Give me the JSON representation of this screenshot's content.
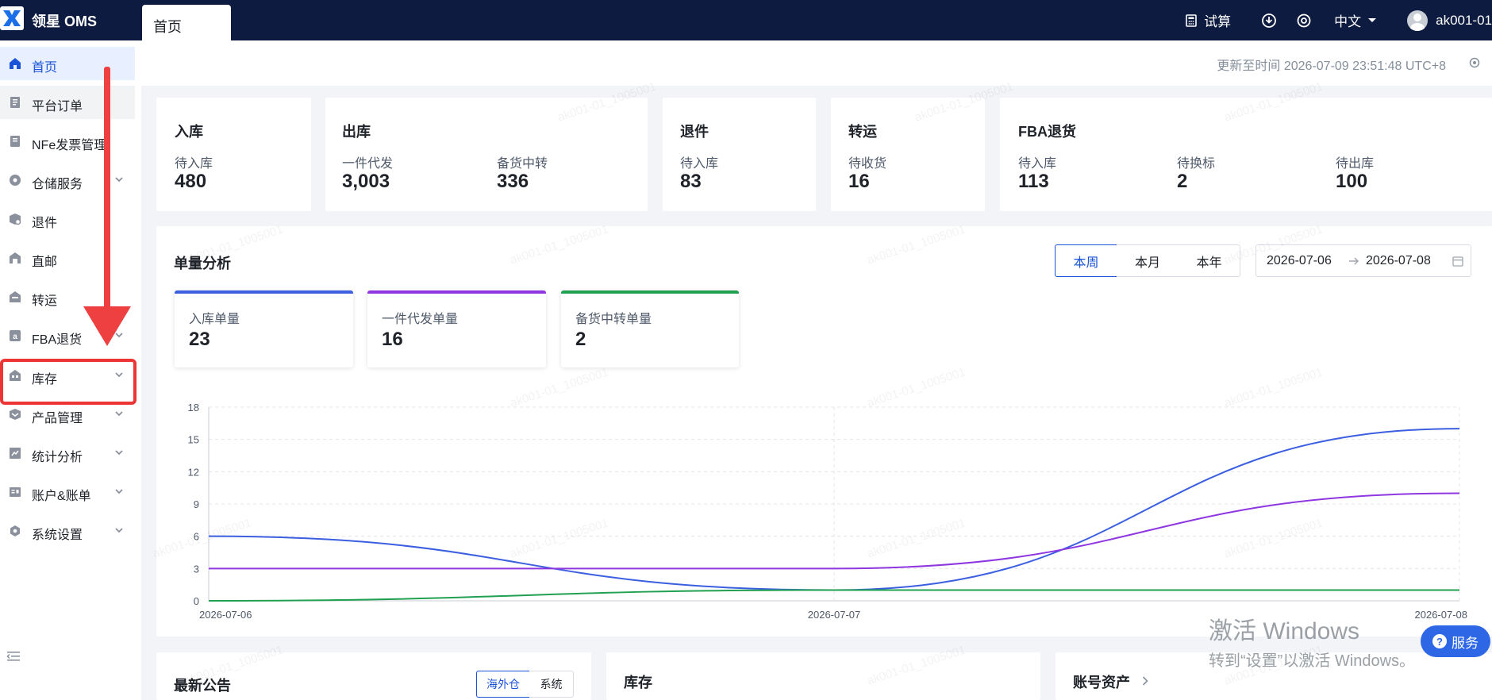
{
  "app": {
    "brand": "领星 OMS",
    "active_tab": "首页"
  },
  "topbar": {
    "trial_label": "试算",
    "language": "中文",
    "username": "ak001-01"
  },
  "sidebar": {
    "items": [
      {
        "label": "首页",
        "icon": "home-icon"
      },
      {
        "label": "平台订单",
        "icon": "order-icon"
      },
      {
        "label": "NFe发票管理",
        "icon": "invoice-icon"
      },
      {
        "label": "仓储服务",
        "icon": "warehouse-service-icon"
      },
      {
        "label": "退件",
        "icon": "return-icon"
      },
      {
        "label": "直邮",
        "icon": "direct-mail-icon"
      },
      {
        "label": "转运",
        "icon": "transfer-icon"
      },
      {
        "label": "FBA退货",
        "icon": "fba-return-icon"
      },
      {
        "label": "库存",
        "icon": "inventory-icon"
      },
      {
        "label": "产品管理",
        "icon": "product-icon"
      },
      {
        "label": "统计分析",
        "icon": "statistics-icon"
      },
      {
        "label": "账户&账单",
        "icon": "account-icon"
      },
      {
        "label": "系统设置",
        "icon": "settings-icon"
      }
    ]
  },
  "header": {
    "update_time": "更新至时间 2026-07-09 23:51:48 UTC+8"
  },
  "summary": {
    "inbound": {
      "title": "入库",
      "pending_label": "待入库",
      "pending_value": "480"
    },
    "outbound": {
      "title": "出库",
      "dropship_label": "一件代发",
      "dropship_value": "3,003",
      "stock_transfer_label": "备货中转",
      "stock_transfer_value": "336"
    },
    "returns": {
      "title": "退件",
      "pending_label": "待入库",
      "pending_value": "83"
    },
    "transfer": {
      "title": "转运",
      "pending_label": "待收货",
      "pending_value": "16"
    },
    "fba": {
      "title": "FBA退货",
      "pending_in_label": "待入库",
      "pending_in_value": "113",
      "relabel_label": "待换标",
      "relabel_value": "2",
      "pending_out_label": "待出库",
      "pending_out_value": "100"
    }
  },
  "analysis": {
    "title": "单量分析",
    "range_tabs": [
      "本周",
      "本月",
      "本年"
    ],
    "date_start": "2026-07-06",
    "date_end": "2026-07-08",
    "metrics": [
      {
        "label": "入库单量",
        "value": "23",
        "color": "#3b5fe0"
      },
      {
        "label": "一件代发单量",
        "value": "16",
        "color": "#8e36e0"
      },
      {
        "label": "备货中转单量",
        "value": "2",
        "color": "#20a050"
      }
    ]
  },
  "chart_data": {
    "type": "line",
    "x": [
      "2026-07-06",
      "2026-07-07",
      "2026-07-08"
    ],
    "y_ticks": [
      0,
      3,
      6,
      9,
      12,
      15,
      18
    ],
    "ylim": [
      0,
      18
    ],
    "grid": true,
    "series": [
      {
        "values": [
          6,
          1,
          16
        ],
        "color": "#3b5fe0"
      },
      {
        "values": [
          3,
          3,
          10
        ],
        "color": "#8e36e0"
      },
      {
        "values": [
          0,
          1,
          1
        ],
        "color": "#20a050"
      }
    ]
  },
  "bottom": {
    "announcements_title": "最新公告",
    "announcement_tabs": [
      "海外仓",
      "系统"
    ],
    "inventory_title": "库存",
    "account_assets_title": "账号资产"
  },
  "windows": {
    "line1": "激活 Windows",
    "line2": "转到“设置”以激活 Windows。"
  },
  "service_label": "服务",
  "watermark_text": "ak001-01_1005001"
}
